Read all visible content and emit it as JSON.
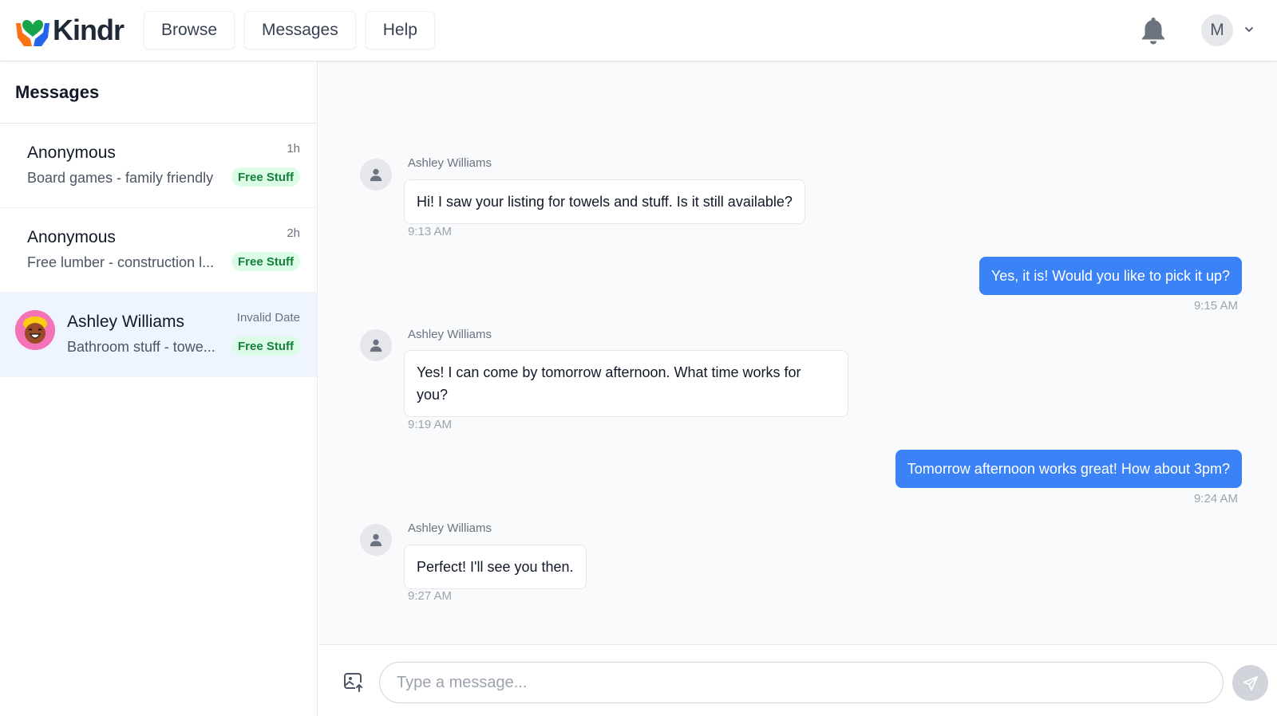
{
  "header": {
    "logo_text": "Kindr",
    "nav": [
      "Browse",
      "Messages",
      "Help"
    ],
    "user_initial": "M"
  },
  "sidebar": {
    "title": "Messages",
    "conversations": [
      {
        "name": "Anonymous",
        "subject": "Board games - family friendly",
        "time": "1h",
        "badge": "Free Stuff"
      },
      {
        "name": "Anonymous",
        "subject": "Free lumber - construction l...",
        "time": "2h",
        "badge": "Free Stuff"
      },
      {
        "name": "Ashley Williams",
        "subject": "Bathroom stuff - towe...",
        "time": "Invalid Date",
        "badge": "Free Stuff"
      }
    ]
  },
  "chat": {
    "messages": [
      {
        "direction": "in",
        "sender": "Ashley Williams",
        "text": "Hi! I saw your listing for towels and stuff. Is it still available?",
        "time": "9:13 AM"
      },
      {
        "direction": "out",
        "text": "Yes, it is! Would you like to pick it up?",
        "time": "9:15 AM"
      },
      {
        "direction": "in",
        "sender": "Ashley Williams",
        "text": "Yes! I can come by tomorrow afternoon. What time works for you?",
        "time": "9:19 AM"
      },
      {
        "direction": "out",
        "text": "Tomorrow afternoon works great! How about 3pm?",
        "time": "9:24 AM"
      },
      {
        "direction": "in",
        "sender": "Ashley Williams",
        "text": "Perfect! I'll see you then.",
        "time": "9:27 AM"
      }
    ]
  },
  "composer": {
    "placeholder": "Type a message...",
    "value": ""
  },
  "icons": {
    "bell": "bell-icon",
    "chevron": "chevron-down-icon",
    "image_upload": "image-upload-icon",
    "send": "send-icon",
    "user": "user-icon"
  },
  "colors": {
    "accent": "#3b82f6",
    "badge_bg": "#dcfce7",
    "badge_text": "#15803d",
    "active_row": "#eff5ff"
  }
}
